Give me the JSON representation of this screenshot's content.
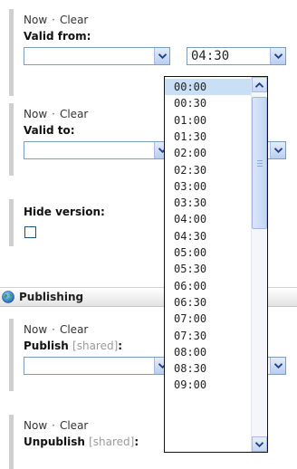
{
  "valid_from": {
    "now_label": "Now",
    "clear_label": "Clear",
    "label": "Valid from:",
    "time_value": "04:30"
  },
  "valid_to": {
    "now_label": "Now",
    "clear_label": "Clear",
    "label": "Valid to:"
  },
  "hide_version": {
    "label": "Hide version:"
  },
  "publishing_section": {
    "title": "Publishing"
  },
  "publish": {
    "now_label": "Now",
    "clear_label": "Clear",
    "label": "Publish",
    "shared_tag": "[shared]",
    "colon": ":"
  },
  "unpublish": {
    "now_label": "Now",
    "clear_label": "Clear",
    "label": "Unpublish",
    "shared_tag": "[shared]",
    "colon": ":"
  },
  "time_dropdown": {
    "options": [
      "00:00",
      "00:30",
      "01:00",
      "01:30",
      "02:00",
      "02:30",
      "03:00",
      "03:30",
      "04:00",
      "04:30",
      "05:00",
      "05:30",
      "06:00",
      "06:30",
      "07:00",
      "07:30",
      "08:00",
      "08:30",
      "09:00"
    ],
    "highlighted": "00:00"
  },
  "colors": {
    "field_border": "#7f9db9",
    "highlight": "#c8dff5",
    "left_bar": "#cfcfcf"
  }
}
